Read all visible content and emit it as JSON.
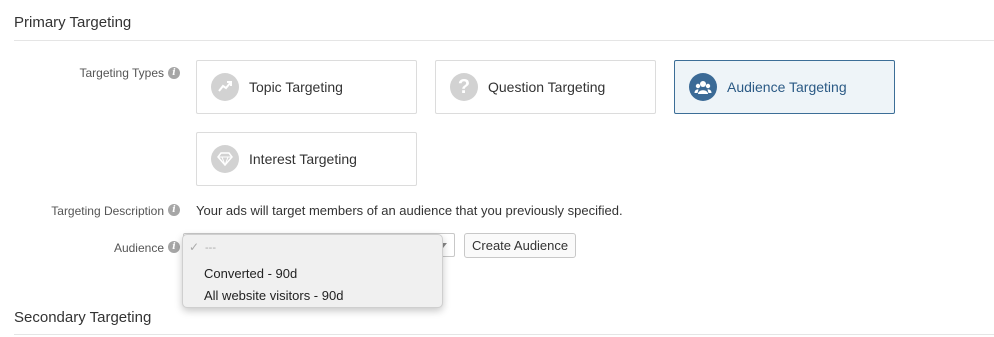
{
  "primary_targeting": {
    "title": "Primary Targeting"
  },
  "targeting_types": {
    "label": "Targeting Types",
    "options": [
      {
        "label": "Topic Targeting",
        "icon": "trend-icon",
        "selected": false
      },
      {
        "label": "Question Targeting",
        "icon": "question-icon",
        "selected": false
      },
      {
        "label": "Audience Targeting",
        "icon": "audience-icon",
        "selected": true
      },
      {
        "label": "Interest Targeting",
        "icon": "diamond-icon",
        "selected": false
      }
    ]
  },
  "targeting_description": {
    "label": "Targeting Description",
    "text": "Your ads will target members of an audience that you previously specified."
  },
  "audience": {
    "label": "Audience",
    "dropdown": {
      "check": "✓",
      "placeholder": "---",
      "options": [
        "Converted - 90d",
        "All website visitors - 90d"
      ]
    },
    "create_button": "Create Audience"
  },
  "secondary_targeting": {
    "title": "Secondary Targeting"
  },
  "colors": {
    "accent": "#3b6a96",
    "selected_bg": "#eef4f8"
  }
}
